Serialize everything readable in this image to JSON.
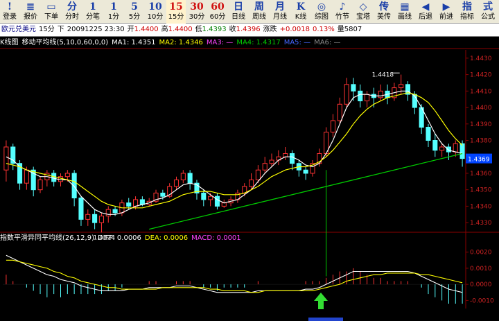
{
  "toolbar": {
    "buttons": [
      {
        "icon": "!",
        "label": "登录",
        "name": "login"
      },
      {
        "icon": "≣",
        "label": "报价",
        "name": "quote"
      },
      {
        "icon": "▭",
        "label": "下单",
        "name": "order"
      },
      {
        "icon": "分",
        "label": "分时",
        "name": "timeshare"
      },
      {
        "icon": "1",
        "label": "分笔",
        "name": "tick"
      },
      {
        "icon": "1",
        "label": "1分",
        "name": "1min"
      },
      {
        "icon": "5",
        "label": "5分",
        "name": "5min"
      },
      {
        "icon": "10",
        "label": "10分",
        "name": "10min"
      },
      {
        "icon": "15",
        "label": "15分",
        "name": "15min"
      },
      {
        "icon": "30",
        "label": "30分",
        "name": "30min"
      },
      {
        "icon": "60",
        "label": "60分",
        "name": "60min"
      },
      {
        "icon": "日",
        "label": "日线",
        "name": "daily"
      },
      {
        "icon": "周",
        "label": "周线",
        "name": "weekly"
      },
      {
        "icon": "月",
        "label": "月线",
        "name": "monthly"
      },
      {
        "icon": "K",
        "label": "K线",
        "name": "kline"
      },
      {
        "icon": "◎",
        "label": "综图",
        "name": "overview"
      },
      {
        "icon": "♪",
        "label": "竹节",
        "name": "bamboo"
      },
      {
        "icon": "◇",
        "label": "宝塔",
        "name": "tower"
      },
      {
        "icon": "传",
        "label": "美传",
        "name": "transfer"
      },
      {
        "icon": "▦",
        "label": "画线",
        "name": "draw"
      },
      {
        "icon": "◀",
        "label": "后退",
        "name": "back"
      },
      {
        "icon": "▶",
        "label": "前进",
        "name": "forward"
      },
      {
        "icon": "指",
        "label": "指标",
        "name": "indicator"
      },
      {
        "icon": "式",
        "label": "公式",
        "name": "formula"
      }
    ],
    "active": "15min"
  },
  "info": {
    "symbol": "欧元兑美元",
    "period": "15分",
    "direction": "下",
    "datetime": "20091225 23:30",
    "open_label": "开",
    "open": "1.4400",
    "high_label": "高",
    "high": "1.4400",
    "low_label": "低",
    "low": "1.4393",
    "close_label": "收",
    "close": "1.4396",
    "state": "涨跌",
    "change": "+0.0018",
    "change_pct": "0.13%",
    "count_label": "量5",
    "count_value": "807"
  },
  "ma_bar": {
    "panel": "K线图",
    "indicator": "移动平均线",
    "params": "(5,10,0,60,0,0)",
    "ma1": "MA1: 1.4351",
    "ma2": "MA2: 1.4346",
    "ma3": "MA3: —",
    "ma4": "MA4: 1.4317",
    "ma5": "MA5: —",
    "ma6": "MA6: —"
  },
  "macd_bar": {
    "indicator": "指数平滑异同平均线",
    "params": "(26,12,9)",
    "diff": "DIFF: 0.0006",
    "dea": "DEA: 0.0006",
    "macd": "MACD: 0.0001"
  },
  "colors": {
    "up": "#ff3333",
    "down": "#55ffff",
    "ma_fast": "#ffffff",
    "ma_mid": "#ffff00",
    "ma_slow": "#00cc00",
    "axis": "#8b0000",
    "price_tag": "#0044ff"
  },
  "chart_data": {
    "type": "candlestick",
    "y_axis": {
      "ticks": [
        "1.4430",
        "1.4420",
        "1.4410",
        "1.4400",
        "1.4390",
        "1.4380",
        "1.4370",
        "1.4360",
        "1.4350",
        "1.4340",
        "1.4330"
      ]
    },
    "ylim": [
      1.4325,
      1.4435
    ],
    "current_price": "1.4369",
    "annotation_high": "1.4418",
    "annotation_low": "1.4324",
    "macd_axis": {
      "ticks": [
        "0.0020",
        "0.0010",
        "0.0000",
        "-0.0010"
      ]
    },
    "macd_ylim": [
      -0.0015,
      0.0025
    ],
    "candles": [
      [
        1.4362,
        1.4376,
        1.438,
        1.4355
      ],
      [
        1.4376,
        1.4366,
        1.4378,
        1.4362
      ],
      [
        1.4366,
        1.4354,
        1.4368,
        1.435
      ],
      [
        1.4354,
        1.4362,
        1.4364,
        1.435
      ],
      [
        1.4362,
        1.435,
        1.4364,
        1.4346
      ],
      [
        1.435,
        1.4356,
        1.4358,
        1.4348
      ],
      [
        1.4356,
        1.436,
        1.4362,
        1.4352
      ],
      [
        1.436,
        1.4355,
        1.4362,
        1.4352
      ],
      [
        1.4355,
        1.4358,
        1.436,
        1.4352
      ],
      [
        1.4358,
        1.436,
        1.4362,
        1.4355
      ],
      [
        1.436,
        1.4345,
        1.4362,
        1.434
      ],
      [
        1.4345,
        1.4332,
        1.4346,
        1.4328
      ],
      [
        1.4332,
        1.4335,
        1.4338,
        1.4328
      ],
      [
        1.4335,
        1.433,
        1.4338,
        1.4326
      ],
      [
        1.433,
        1.4334,
        1.4336,
        1.4324
      ],
      [
        1.4334,
        1.4338,
        1.434,
        1.433
      ],
      [
        1.4338,
        1.4336,
        1.434,
        1.4334
      ],
      [
        1.4336,
        1.4342,
        1.4344,
        1.4334
      ],
      [
        1.4342,
        1.434,
        1.4345,
        1.4338
      ],
      [
        1.434,
        1.4344,
        1.4346,
        1.4338
      ],
      [
        1.4344,
        1.4341,
        1.4346,
        1.434
      ],
      [
        1.4341,
        1.4343,
        1.4345,
        1.434
      ],
      [
        1.4343,
        1.4348,
        1.435,
        1.4342
      ],
      [
        1.4348,
        1.4346,
        1.435,
        1.4344
      ],
      [
        1.4346,
        1.4352,
        1.4354,
        1.4345
      ],
      [
        1.4352,
        1.4356,
        1.4358,
        1.435
      ],
      [
        1.4356,
        1.436,
        1.4362,
        1.4354
      ],
      [
        1.436,
        1.4354,
        1.4362,
        1.435
      ],
      [
        1.4354,
        1.4348,
        1.4356,
        1.4344
      ],
      [
        1.4348,
        1.4344,
        1.435,
        1.434
      ],
      [
        1.4344,
        1.4346,
        1.4348,
        1.434
      ],
      [
        1.4346,
        1.434,
        1.4348,
        1.4338
      ],
      [
        1.434,
        1.4342,
        1.4344,
        1.4339
      ],
      [
        1.4342,
        1.4344,
        1.4346,
        1.434
      ],
      [
        1.4344,
        1.4348,
        1.435,
        1.4342
      ],
      [
        1.4348,
        1.4352,
        1.4354,
        1.4346
      ],
      [
        1.4352,
        1.4356,
        1.436,
        1.435
      ],
      [
        1.4356,
        1.4362,
        1.4365,
        1.4354
      ],
      [
        1.4362,
        1.4366,
        1.437,
        1.436
      ],
      [
        1.4366,
        1.4368,
        1.4372,
        1.4364
      ],
      [
        1.4368,
        1.437,
        1.4374,
        1.4365
      ],
      [
        1.437,
        1.4372,
        1.4376,
        1.4368
      ],
      [
        1.4372,
        1.4366,
        1.4374,
        1.4362
      ],
      [
        1.4366,
        1.4362,
        1.4368,
        1.4358
      ],
      [
        1.4362,
        1.436,
        1.4364,
        1.4356
      ],
      [
        1.436,
        1.4366,
        1.4368,
        1.4358
      ],
      [
        1.4366,
        1.4372,
        1.4375,
        1.4364
      ],
      [
        1.4372,
        1.4385,
        1.4388,
        1.437
      ],
      [
        1.4385,
        1.4392,
        1.4396,
        1.4382
      ],
      [
        1.4392,
        1.4402,
        1.4406,
        1.439
      ],
      [
        1.4402,
        1.4414,
        1.4418,
        1.44
      ],
      [
        1.4414,
        1.441,
        1.4418,
        1.4404
      ],
      [
        1.441,
        1.4404,
        1.4414,
        1.44
      ],
      [
        1.4404,
        1.4408,
        1.441,
        1.44
      ],
      [
        1.4408,
        1.4406,
        1.4412,
        1.44
      ],
      [
        1.4406,
        1.441,
        1.4414,
        1.4404
      ],
      [
        1.441,
        1.4406,
        1.4414,
        1.4402
      ],
      [
        1.4406,
        1.4412,
        1.4415,
        1.4404
      ],
      [
        1.4412,
        1.4414,
        1.442,
        1.4408
      ],
      [
        1.4414,
        1.4408,
        1.4416,
        1.4404
      ],
      [
        1.4408,
        1.44,
        1.441,
        1.4396
      ],
      [
        1.44,
        1.4388,
        1.4402,
        1.4384
      ],
      [
        1.4388,
        1.438,
        1.439,
        1.4376
      ],
      [
        1.438,
        1.4374,
        1.4384,
        1.437
      ],
      [
        1.4374,
        1.4376,
        1.4378,
        1.437
      ],
      [
        1.4376,
        1.4373,
        1.4378,
        1.4368
      ],
      [
        1.4373,
        1.4378,
        1.438,
        1.437
      ],
      [
        1.4378,
        1.4369,
        1.438,
        1.4364
      ]
    ],
    "ma_fast": [
      1.437,
      1.4368,
      1.4364,
      1.4362,
      1.436,
      1.4358,
      1.4358,
      1.4357,
      1.4356,
      1.4356,
      1.4352,
      1.4346,
      1.4342,
      1.4338,
      1.4336,
      1.4335,
      1.4335,
      1.4336,
      1.4338,
      1.434,
      1.4341,
      1.4342,
      1.4344,
      1.4345,
      1.4347,
      1.435,
      1.4353,
      1.4354,
      1.4353,
      1.435,
      1.4347,
      1.4344,
      1.4342,
      1.4343,
      1.4344,
      1.4347,
      1.435,
      1.4355,
      1.436,
      1.4364,
      1.4368,
      1.437,
      1.437,
      1.4368,
      1.4365,
      1.4364,
      1.4366,
      1.4372,
      1.438,
      1.439,
      1.44,
      1.4406,
      1.4408,
      1.4408,
      1.4407,
      1.4407,
      1.4408,
      1.4409,
      1.441,
      1.441,
      1.4407,
      1.44,
      1.4392,
      1.4384,
      1.4378,
      1.4374,
      1.4373,
      1.4372
    ],
    "ma_mid": [
      1.4366,
      1.4365,
      1.4364,
      1.4362,
      1.4361,
      1.436,
      1.4359,
      1.4358,
      1.4357,
      1.4356,
      1.4355,
      1.4352,
      1.4349,
      1.4346,
      1.4343,
      1.4341,
      1.434,
      1.4339,
      1.4339,
      1.4339,
      1.4339,
      1.434,
      1.4341,
      1.4342,
      1.4343,
      1.4345,
      1.4347,
      1.4348,
      1.4349,
      1.4349,
      1.4349,
      1.4348,
      1.4347,
      1.4347,
      1.4347,
      1.4348,
      1.435,
      1.4352,
      1.4355,
      1.4358,
      1.436,
      1.4362,
      1.4363,
      1.4364,
      1.4364,
      1.4365,
      1.4367,
      1.437,
      1.4374,
      1.4379,
      1.4384,
      1.439,
      1.4395,
      1.4399,
      1.4402,
      1.4404,
      1.4406,
      1.4407,
      1.4408,
      1.4409,
      1.4408,
      1.4406,
      1.4403,
      1.4398,
      1.4392,
      1.4386,
      1.4381,
      1.4377
    ],
    "ma_slow": {
      "start_index": 21,
      "from": 1.4326,
      "to": 1.4372
    },
    "diff": [
      0.0018,
      0.0016,
      0.0014,
      0.0012,
      0.001,
      0.0008,
      0.0006,
      0.0005,
      0.0003,
      0.0002,
      0.0001,
      -0.0001,
      -0.0002,
      -0.0003,
      -0.0004,
      -0.0004,
      -0.0004,
      -0.0004,
      -0.0003,
      -0.0003,
      -0.0003,
      -0.0002,
      -0.0002,
      -0.0002,
      -0.0002,
      -0.0001,
      -0.0001,
      -0.0001,
      -0.0002,
      -0.0003,
      -0.0004,
      -0.0005,
      -0.0005,
      -0.0005,
      -0.0005,
      -0.0005,
      -0.0005,
      -0.0004,
      -0.0004,
      -0.0004,
      -0.0004,
      -0.0004,
      -0.0004,
      -0.0004,
      -0.0003,
      -0.0003,
      -0.0002,
      0.0,
      0.0002,
      0.0004,
      0.0006,
      0.0008,
      0.0008,
      0.0008,
      0.0008,
      0.0008,
      0.0008,
      0.0008,
      0.0008,
      0.0008,
      0.0007,
      0.0005,
      0.0003,
      0.0001,
      -0.0001,
      -0.0003,
      -0.0004,
      -0.0005
    ],
    "dea": [
      0.0015,
      0.0015,
      0.0014,
      0.0013,
      0.0012,
      0.0011,
      0.001,
      0.0008,
      0.0007,
      0.0005,
      0.0004,
      0.0002,
      0.0001,
      0.0,
      -0.0001,
      -0.0002,
      -0.0002,
      -0.0003,
      -0.0003,
      -0.0003,
      -0.0003,
      -0.0003,
      -0.0003,
      -0.0002,
      -0.0002,
      -0.0002,
      -0.0002,
      -0.0002,
      -0.0002,
      -0.0002,
      -0.0003,
      -0.0003,
      -0.0004,
      -0.0004,
      -0.0004,
      -0.0004,
      -0.0005,
      -0.0005,
      -0.0004,
      -0.0004,
      -0.0004,
      -0.0004,
      -0.0004,
      -0.0004,
      -0.0004,
      -0.0004,
      -0.0003,
      -0.0002,
      -0.0001,
      0.0,
      0.0002,
      0.0003,
      0.0004,
      0.0005,
      0.0006,
      0.0006,
      0.0007,
      0.0007,
      0.0007,
      0.0007,
      0.0007,
      0.0006,
      0.0006,
      0.0005,
      0.0004,
      0.0003,
      0.0002,
      0.0001
    ]
  }
}
